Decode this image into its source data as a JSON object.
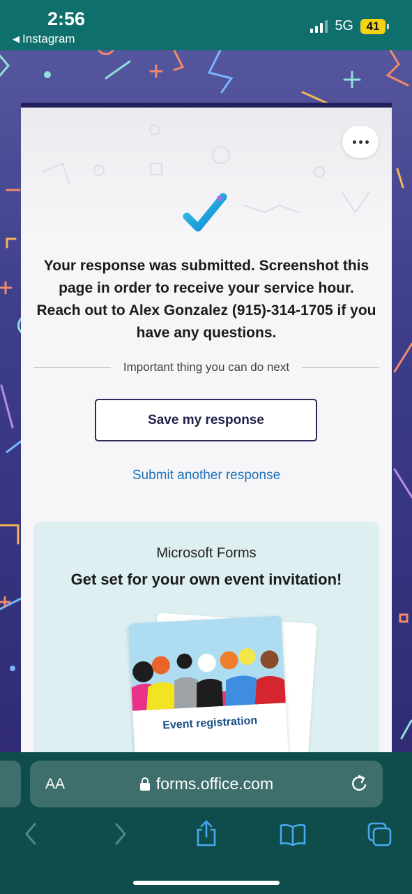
{
  "status_bar": {
    "time": "2:56",
    "back_app": "Instagram",
    "network": "5G",
    "battery": "41"
  },
  "card": {
    "more_icon": "more-options-icon",
    "confirmation_lines": [
      "Your response was submitted. Screenshot this",
      "page in order to receive your service hour.",
      "Reach out to Alex Gonzalez (915)-314-1705 if you",
      "have any questions."
    ],
    "next_divider_label": "Important thing you can do next",
    "save_button": "Save my response",
    "submit_another_link": "Submit another response",
    "promo": {
      "brand": "Microsoft Forms",
      "title": "Get set for your own event invitation!",
      "invite_label": "Event registration"
    }
  },
  "browser": {
    "text_size_label": "AA",
    "url": "forms.office.com",
    "icons": [
      "back-icon",
      "forward-icon",
      "share-icon",
      "bookmarks-icon",
      "tabs-icon"
    ]
  },
  "colors": {
    "status_bg": "#0e6f6c",
    "card_accent": "#22215a",
    "link": "#1f72b8",
    "browser_bg": "#0f4d4c"
  }
}
